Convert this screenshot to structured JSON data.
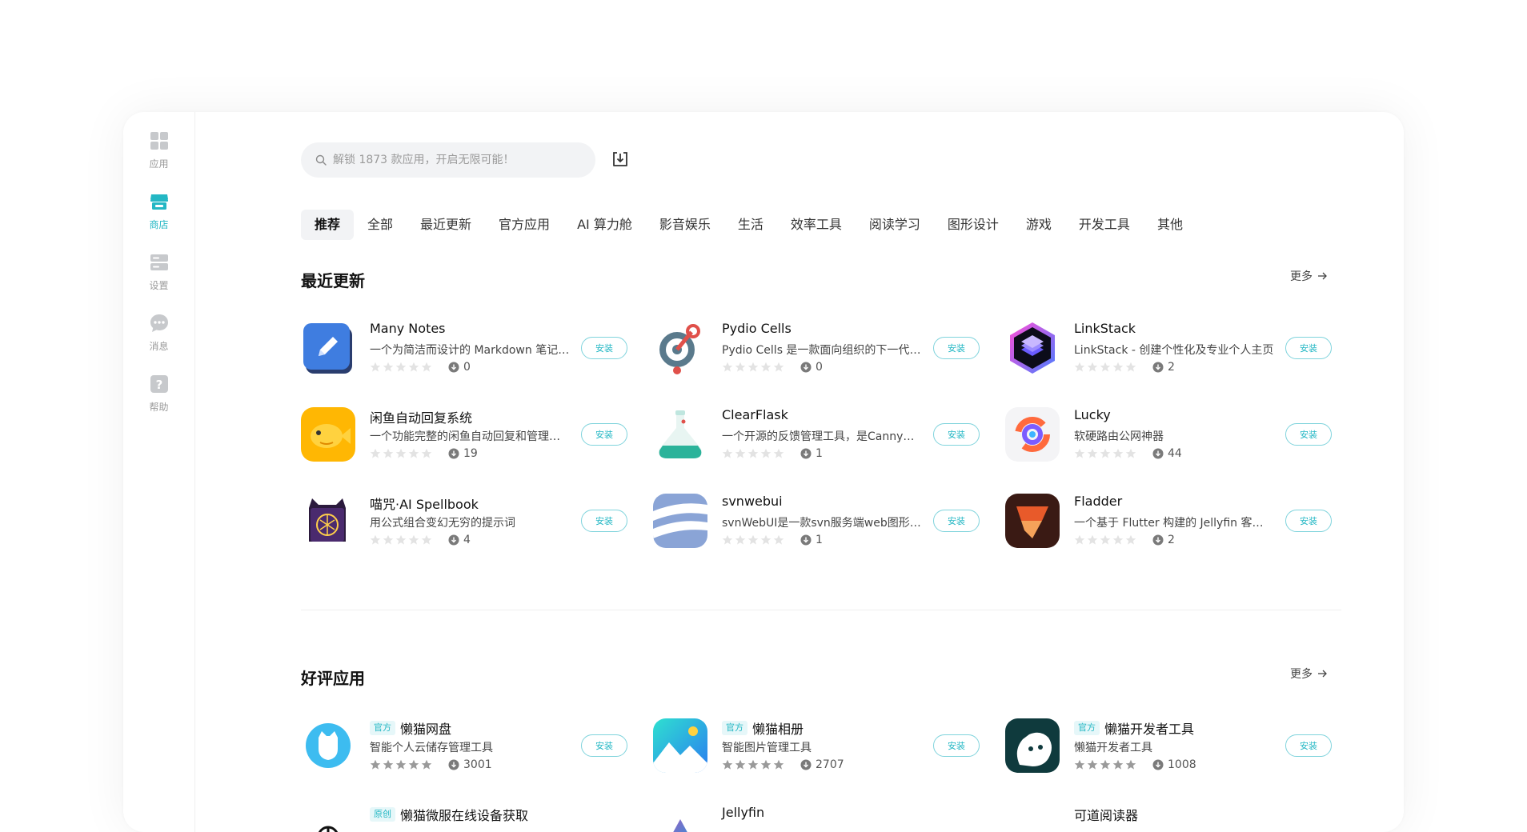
{
  "sidebar": {
    "items": [
      {
        "label": "应用",
        "icon": "grid-icon",
        "active": false
      },
      {
        "label": "商店",
        "icon": "store-icon",
        "active": true
      },
      {
        "label": "设置",
        "icon": "settings-icon",
        "active": false
      },
      {
        "label": "消息",
        "icon": "message-icon",
        "active": false
      },
      {
        "label": "帮助",
        "icon": "help-icon",
        "active": false
      }
    ]
  },
  "search": {
    "placeholder": "解锁 1873 款应用，开启无限可能！",
    "value": ""
  },
  "tabs": [
    "推荐",
    "全部",
    "最近更新",
    "官方应用",
    "AI 算力舱",
    "影音娱乐",
    "生活",
    "效率工具",
    "阅读学习",
    "图形设计",
    "游戏",
    "开发工具",
    "其他"
  ],
  "active_tab": "推荐",
  "sections": {
    "recent": {
      "title": "最近更新",
      "more": "更多",
      "apps": [
        {
          "name": "Many Notes",
          "desc": "一个为简洁而设计的 Markdown 笔记应用",
          "downloads": "0",
          "install": "安装",
          "stars": 0
        },
        {
          "name": "Pydio Cells",
          "desc": "Pydio Cells 是一款面向组织的下一代文件共享平台",
          "downloads": "0",
          "install": "安装",
          "stars": 0
        },
        {
          "name": "LinkStack",
          "desc": "LinkStack - 创建个性化及专业个人主页",
          "downloads": "2",
          "install": "安装",
          "stars": 0
        },
        {
          "name": "闲鱼自动回复系统",
          "desc": "一个功能完整的闲鱼自动回复和管理系统",
          "downloads": "19",
          "install": "安装",
          "stars": 0
        },
        {
          "name": "ClearFlask",
          "desc": "一个开源的反馈管理工具，是Canny的替代品",
          "downloads": "1",
          "install": "安装",
          "stars": 0
        },
        {
          "name": "Lucky",
          "desc": "软硬路由公网神器",
          "downloads": "44",
          "install": "安装",
          "stars": 0
        },
        {
          "name": "喵咒·AI Spellbook",
          "desc": "用公式组合变幻无穷的提示词",
          "downloads": "4",
          "install": "安装",
          "stars": 0
        },
        {
          "name": "svnwebui",
          "desc": "svnWebUI是一款svn服务端web图形化管理工具",
          "downloads": "1",
          "install": "安装",
          "stars": 0
        },
        {
          "name": "Fladder",
          "desc": "一个基于 Flutter 构建的 Jellyfin 客户端",
          "downloads": "2",
          "install": "安装",
          "stars": 0
        }
      ]
    },
    "top_rated": {
      "title": "好评应用",
      "more": "更多",
      "apps": [
        {
          "badge": "官方",
          "name": "懒猫网盘",
          "desc": "智能个人云储存管理工具",
          "downloads": "3001",
          "install": "安装",
          "stars": 5
        },
        {
          "badge": "官方",
          "name": "懒猫相册",
          "desc": "智能图片管理工具",
          "downloads": "2707",
          "install": "安装",
          "stars": 5
        },
        {
          "badge": "官方",
          "name": "懒猫开发者工具",
          "desc": "懒猫开发者工具",
          "downloads": "1008",
          "install": "安装",
          "stars": 5
        },
        {
          "badge": "原创",
          "name": "懒猫微服在线设备获取",
          "desc": "",
          "downloads": "",
          "install": "",
          "stars": 0
        },
        {
          "badge": "",
          "name": "Jellyfin",
          "desc": "",
          "downloads": "",
          "install": "",
          "stars": 0
        },
        {
          "badge": "",
          "name": "可道阅读器",
          "desc": "",
          "downloads": "",
          "install": "",
          "stars": 0
        }
      ]
    }
  },
  "colors": {
    "accent": "#23b7c4",
    "star_empty": "#e3e3e3",
    "star_filled": "#9a9a9a"
  }
}
